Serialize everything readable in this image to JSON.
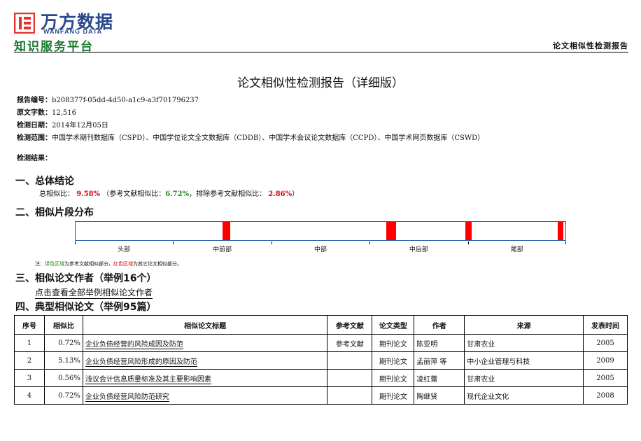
{
  "header": {
    "logo_cn": "万方数据",
    "logo_en": "WANFANG DATA",
    "slogan": "知识服务平台",
    "right_title": "论文相似性检测报告",
    "colors": {
      "brand_blue": "#2b4a8d",
      "brand_red": "#e8302c",
      "slogan_green": "#1a7a2e"
    }
  },
  "title": "论文相似性检测报告（详细版）",
  "meta": {
    "report_no_label": "报告编号：",
    "report_no": "b208377f-05dd-4d50-a1c9-a3f701796237",
    "word_count_label": "原文字数：",
    "word_count": "12,516",
    "date_label": "检测日期：",
    "date": "2014年12月05日",
    "scope_label": "检测范围：",
    "scope": "中国学术期刊数据库（CSPD）、中国学位论文全文数据库（CDDB）、中国学术会议论文数据库（CCPD）、中国学术网页数据库（CSWD）",
    "result_label": "检测结果："
  },
  "section1": {
    "heading": "一、总体结论",
    "total_label": "总相似比：",
    "total_value": "9.58%",
    "ref_label": "（参考文献相似比：",
    "ref_value": "6.72%",
    "excl_label": "，排除参考文献相似比：",
    "excl_value": "2.86%",
    "close": "）"
  },
  "section2": {
    "heading": "二、相似片段分布",
    "segment_color": "#ff0000",
    "segments": [
      {
        "start": 0.3,
        "end": 0.315
      },
      {
        "start": 0.634,
        "end": 0.654
      },
      {
        "start": 0.795,
        "end": 0.808
      },
      {
        "start": 0.984,
        "end": 0.996
      }
    ],
    "axis_labels": [
      "头部",
      "中前部",
      "中部",
      "中后部",
      "尾部"
    ],
    "note_prefix": "注：",
    "note_green": "绿色区域",
    "note_mid": "为参考文献相似部分，",
    "note_red": "红色区域",
    "note_suffix": "为其它论文相似部分。"
  },
  "section3": {
    "heading": "三、相似论文作者（举例16个）",
    "link": "点击查看全部举例相似论文作者"
  },
  "section4": {
    "heading": "四、典型相似论文（举例95篇）",
    "columns": [
      "序号",
      "相似比",
      "相似论文标题",
      "参考文献",
      "论文类型",
      "作者",
      "来源",
      "发表时间"
    ],
    "rows": [
      {
        "no": "1",
        "ratio": "0.72%",
        "title": "企业负债经营的风险成因及防范",
        "ref": "参考文献",
        "type": "期刊论文",
        "author": "陈亚明",
        "source": "甘肃农业",
        "year": "2005"
      },
      {
        "no": "2",
        "ratio": "5.13%",
        "title": "企业负债经营风险形成的原因及防范",
        "ref": "",
        "type": "期刊论文",
        "author": "孟丽萍 等",
        "source": "中小企业管理与科技",
        "year": "2009"
      },
      {
        "no": "3",
        "ratio": "0.56%",
        "title": "浅议会计信息质量标准及其主要影响因素",
        "ref": "",
        "type": "期刊论文",
        "author": "凌红蕾",
        "source": "甘肃农业",
        "year": "2005"
      },
      {
        "no": "4",
        "ratio": "0.72%",
        "title": "企业负债经营风险防范研究",
        "ref": "",
        "type": "期刊论文",
        "author": "陶继贤",
        "source": "现代企业文化",
        "year": "2008"
      }
    ]
  }
}
